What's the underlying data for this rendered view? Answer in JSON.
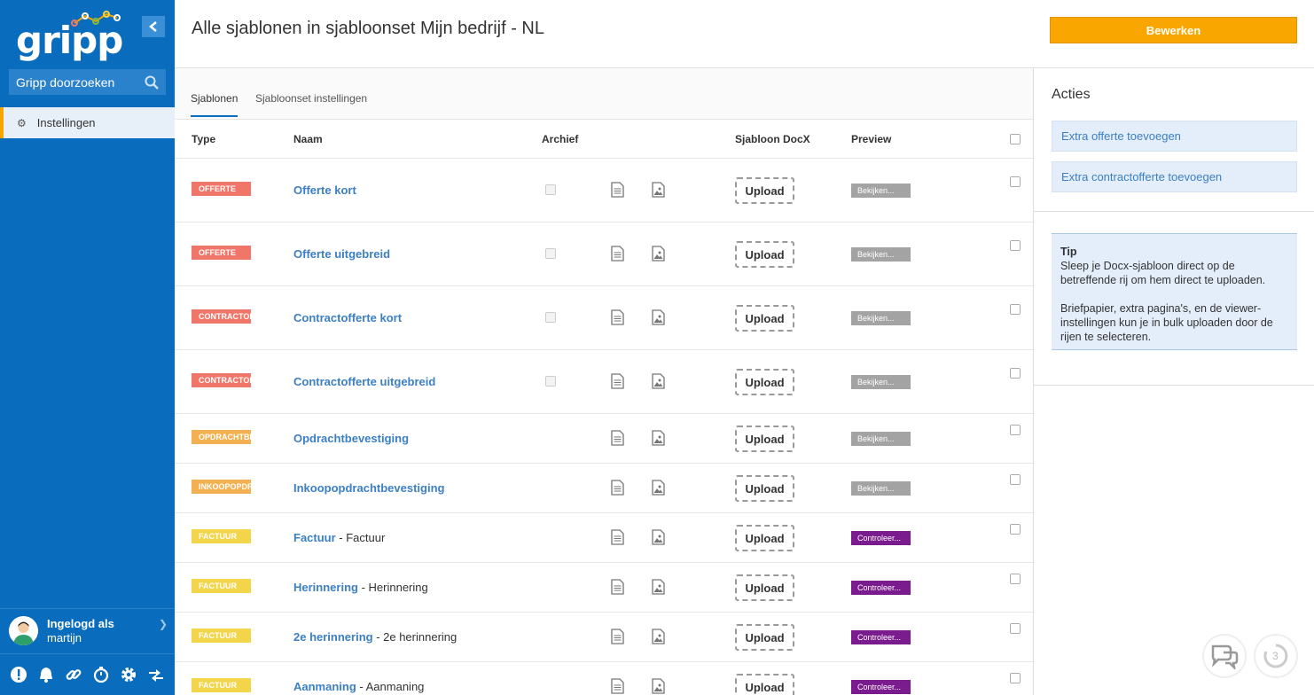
{
  "sidebar": {
    "logo_text": "gripp",
    "search_label": "Gripp doorzoeken",
    "nav": [
      {
        "label": "Instellingen",
        "icon": "gear-icon"
      }
    ],
    "user": {
      "line1": "Ingelogd als",
      "line2": "martijn"
    },
    "bottom_icons": [
      "alert-icon",
      "bell-icon",
      "link-icon",
      "timer-icon",
      "gear-icon",
      "swap-icon"
    ]
  },
  "header": {
    "title": "Alle sjablonen in sjabloonset Mijn bedrijf - NL",
    "edit_label": "Bewerken"
  },
  "tabs": [
    "Sjablonen",
    "Sjabloonset instellingen"
  ],
  "table": {
    "headers": {
      "type": "Type",
      "name": "Naam",
      "archive": "Archief",
      "docx": "Sjabloon DocX",
      "preview": "Preview"
    },
    "upload_label": "Upload",
    "rows": [
      {
        "type": "Offerte",
        "type_color": "#f0766a",
        "name": "Offerte kort",
        "suffix": "",
        "archive": true,
        "preview": "Bekijken...",
        "preview_color": "#a3a3a3"
      },
      {
        "type": "Offerte",
        "type_color": "#f0766a",
        "name": "Offerte uitgebreid",
        "suffix": "",
        "archive": true,
        "preview": "Bekijken...",
        "preview_color": "#a3a3a3"
      },
      {
        "type": "Contractofferte",
        "type_color": "#f0766a",
        "name": "Contractofferte kort",
        "suffix": "",
        "archive": true,
        "preview": "Bekijken...",
        "preview_color": "#a3a3a3"
      },
      {
        "type": "Contractofferte",
        "type_color": "#f0766a",
        "name": "Contractofferte uitgebreid",
        "suffix": "",
        "archive": true,
        "preview": "Bekijken...",
        "preview_color": "#a3a3a3"
      },
      {
        "type": "Opdrachtbevestiging",
        "type_color": "#f3b050",
        "name": "Opdrachtbevestiging",
        "suffix": "",
        "archive": false,
        "preview": "Bekijken...",
        "preview_color": "#a3a3a3"
      },
      {
        "type": "Inkoopopdracht",
        "type_color": "#f3b050",
        "name": "Inkoopopdrachtbevestiging",
        "suffix": "",
        "archive": false,
        "preview": "Bekijken...",
        "preview_color": "#a3a3a3"
      },
      {
        "type": "Factuur",
        "type_color": "#f2d54a",
        "name": "Factuur",
        "suffix": " - Factuur",
        "archive": false,
        "preview": "Controleer...",
        "preview_color": "#7b1c8e"
      },
      {
        "type": "Factuur",
        "type_color": "#f2d54a",
        "name": "Herinnering",
        "suffix": " - Herinnering",
        "archive": false,
        "preview": "Controleer...",
        "preview_color": "#7b1c8e"
      },
      {
        "type": "Factuur",
        "type_color": "#f2d54a",
        "name": "2e herinnering",
        "suffix": " - 2e herinnering",
        "archive": false,
        "preview": "Controleer...",
        "preview_color": "#7b1c8e"
      },
      {
        "type": "Factuur",
        "type_color": "#f2d54a",
        "name": "Aanmaning",
        "suffix": " - Aanmaning",
        "archive": false,
        "preview": "Controleer...",
        "preview_color": "#7b1c8e"
      }
    ]
  },
  "right": {
    "title": "Acties",
    "actions": [
      "Extra offerte toevoegen",
      "Extra contractofferte toevoegen"
    ],
    "tip_title": "Tip",
    "tip_p1": "Sleep je Docx-sjabloon direct op de betreffende rij om hem direct te uploaden.",
    "tip_p2": "Briefpapier, extra pagina's, en de viewer-instellingen kun je in bulk uploaden door de rijen te selecteren."
  },
  "float": {
    "badge": "3"
  }
}
